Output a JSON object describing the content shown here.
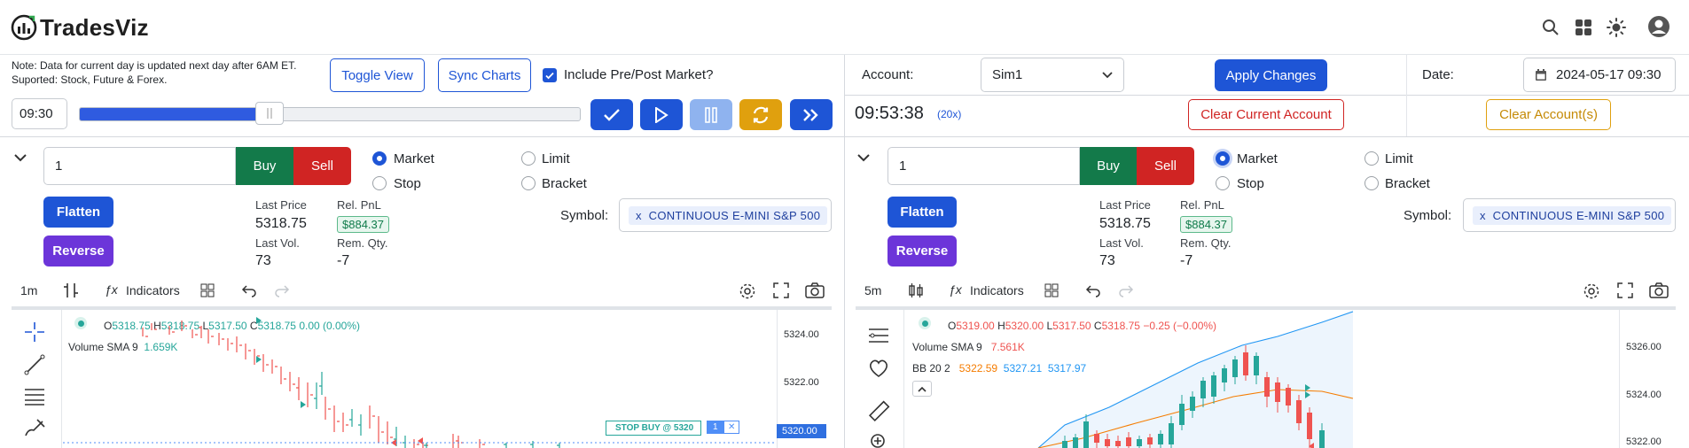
{
  "brand": {
    "name": "TradesViz",
    "logo_icon": "chart-logo-icon"
  },
  "header_icons": [
    "search-icon",
    "apps-grid-icon",
    "sun-icon",
    "user-account-icon"
  ],
  "left": {
    "note_line1": "Note: Data for current day is updated next day after 6AM ET.",
    "note_line2": "Suported: Stock, Future & Forex.",
    "toggle_view": "Toggle View",
    "sync_charts": "Sync Charts",
    "include_prepost": "Include Pre/Post Market?",
    "include_prepost_checked": true,
    "time_value": "09:30",
    "replay_progress_pct": 38,
    "panel": {
      "qty": "1",
      "buy": "Buy",
      "sell": "Sell",
      "order_types": [
        "Market",
        "Limit",
        "Stop",
        "Bracket"
      ],
      "selected": "Market",
      "flatten": "Flatten",
      "reverse": "Reverse",
      "last_price_label": "Last Price",
      "last_price": "5318.75",
      "rel_pnl_label": "Rel. PnL",
      "rel_pnl": "$884.37",
      "last_vol_label": "Last Vol.",
      "last_vol": "73",
      "rem_qty_label": "Rem. Qty.",
      "rem_qty": "-7",
      "symbol_label": "Symbol:",
      "symbol_remove": "x",
      "symbol": "CONTINUOUS E-MINI S&P 500"
    },
    "chart": {
      "interval": "1m",
      "indicators": "Indicators",
      "o_label": "O",
      "o": "5318.75",
      "h_label": "H",
      "h": "5318.75",
      "l_label": "L",
      "l": "5317.50",
      "c_label": "C",
      "c": "5318.75",
      "change": "0.00 (0.00%)",
      "volume_label": "Volume SMA 9",
      "volume": "1.659K",
      "y_ticks": [
        "5324.00",
        "5322.00",
        "5320.00"
      ],
      "stop_order": "STOP BUY @ 5320",
      "stop_qty": "1",
      "stop_close": "✕"
    }
  },
  "right": {
    "account_label": "Account:",
    "account": "Sim1",
    "apply_changes": "Apply Changes",
    "date_label": "Date:",
    "date_value": "2024-05-17 09:30",
    "clock": "09:53:38",
    "speed": "(20x)",
    "clear_current": "Clear Current Account",
    "clear_accounts": "Clear Account(s)",
    "panel": {
      "qty": "1",
      "buy": "Buy",
      "sell": "Sell",
      "order_types": [
        "Market",
        "Limit",
        "Stop",
        "Bracket"
      ],
      "selected": "Market",
      "flatten": "Flatten",
      "reverse": "Reverse",
      "last_price_label": "Last Price",
      "last_price": "5318.75",
      "rel_pnl_label": "Rel. PnL",
      "rel_pnl": "$884.37",
      "last_vol_label": "Last Vol.",
      "last_vol": "73",
      "rem_qty_label": "Rem. Qty.",
      "rem_qty": "-7",
      "symbol_label": "Symbol:",
      "symbol_remove": "x",
      "symbol": "CONTINUOUS E-MINI S&P 500"
    },
    "chart": {
      "interval": "5m",
      "indicators": "Indicators",
      "o_label": "O",
      "o": "5319.00",
      "h_label": "H",
      "h": "5320.00",
      "l_label": "L",
      "l": "5317.50",
      "c_label": "C",
      "c": "5318.75",
      "change": "−0.25 (−0.00%)",
      "volume_label": "Volume SMA 9",
      "volume": "7.561K",
      "bb_label": "BB 20 2",
      "bb_mid": "5322.59",
      "bb_upper": "5327.21",
      "bb_lower": "5317.97",
      "y_ticks": [
        "5326.00",
        "5324.00",
        "5322.00"
      ]
    }
  },
  "colors": {
    "accent": "#1e55d6",
    "buy": "#137a4a",
    "sell": "#d02423",
    "reverse": "#6c35d9",
    "amber": "#e0a00e",
    "up": "#26a69a",
    "down": "#ef5350"
  }
}
